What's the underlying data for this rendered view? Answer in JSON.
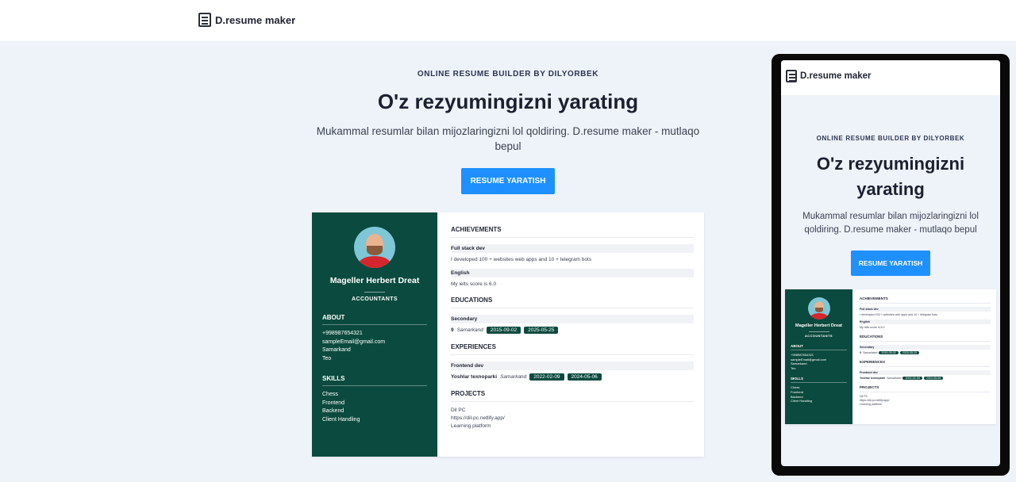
{
  "header": {
    "logo_text": "D.resume maker"
  },
  "hero": {
    "eyebrow": "ONLINE RESUME BUILDER BY DILYORBEK",
    "title": "O'z rezyumingizni yarating",
    "subtitle": "Mukammal resumlar bilan mijozlaringizni lol qoldiring. D.resume maker - mutlaqo bepul",
    "cta_label": "RESUME YARATISH"
  },
  "resume": {
    "name": "Mageller Herbert Dreat",
    "role": "ACCOUNTANTS",
    "about_title": "ABOUT",
    "about": [
      "+998987654321",
      "sampleEmail@gmail.com",
      "Samarkand",
      "Teo"
    ],
    "skills_title": "SKILLS",
    "skills": [
      "Chess",
      "Frontend",
      "Backend",
      "Client Handling"
    ],
    "achievements_title": "ACHIEVEMENTS",
    "achievements": [
      {
        "title": "Full stack dev",
        "text": "I developed 100 + websites web apps and 10 + telegram bots"
      },
      {
        "title": "English",
        "text": "My ielts score is 6.0"
      }
    ],
    "educations_title": "EDUCATIONS",
    "education": {
      "title": "Secondary",
      "school": "9",
      "city": "Samarkand",
      "start": "2015-09-02",
      "end": "2025-05-25"
    },
    "experiences_title": "EXPERIENCES",
    "experience": {
      "title": "Frontend dev",
      "company": "Yoshlar texnoparki",
      "city": "Samarkand",
      "start": "2022-02-09",
      "end": "2024-05-06"
    },
    "projects_title": "PROJECTS",
    "projects": [
      "Dil PC",
      "https://dil-pc.netlify.app/",
      "Learning platform"
    ]
  },
  "colors": {
    "accent": "#1e90ff",
    "resume_side": "#0b4a3e",
    "background": "#eef2f9"
  },
  "icons": {
    "logo": "document-icon"
  }
}
